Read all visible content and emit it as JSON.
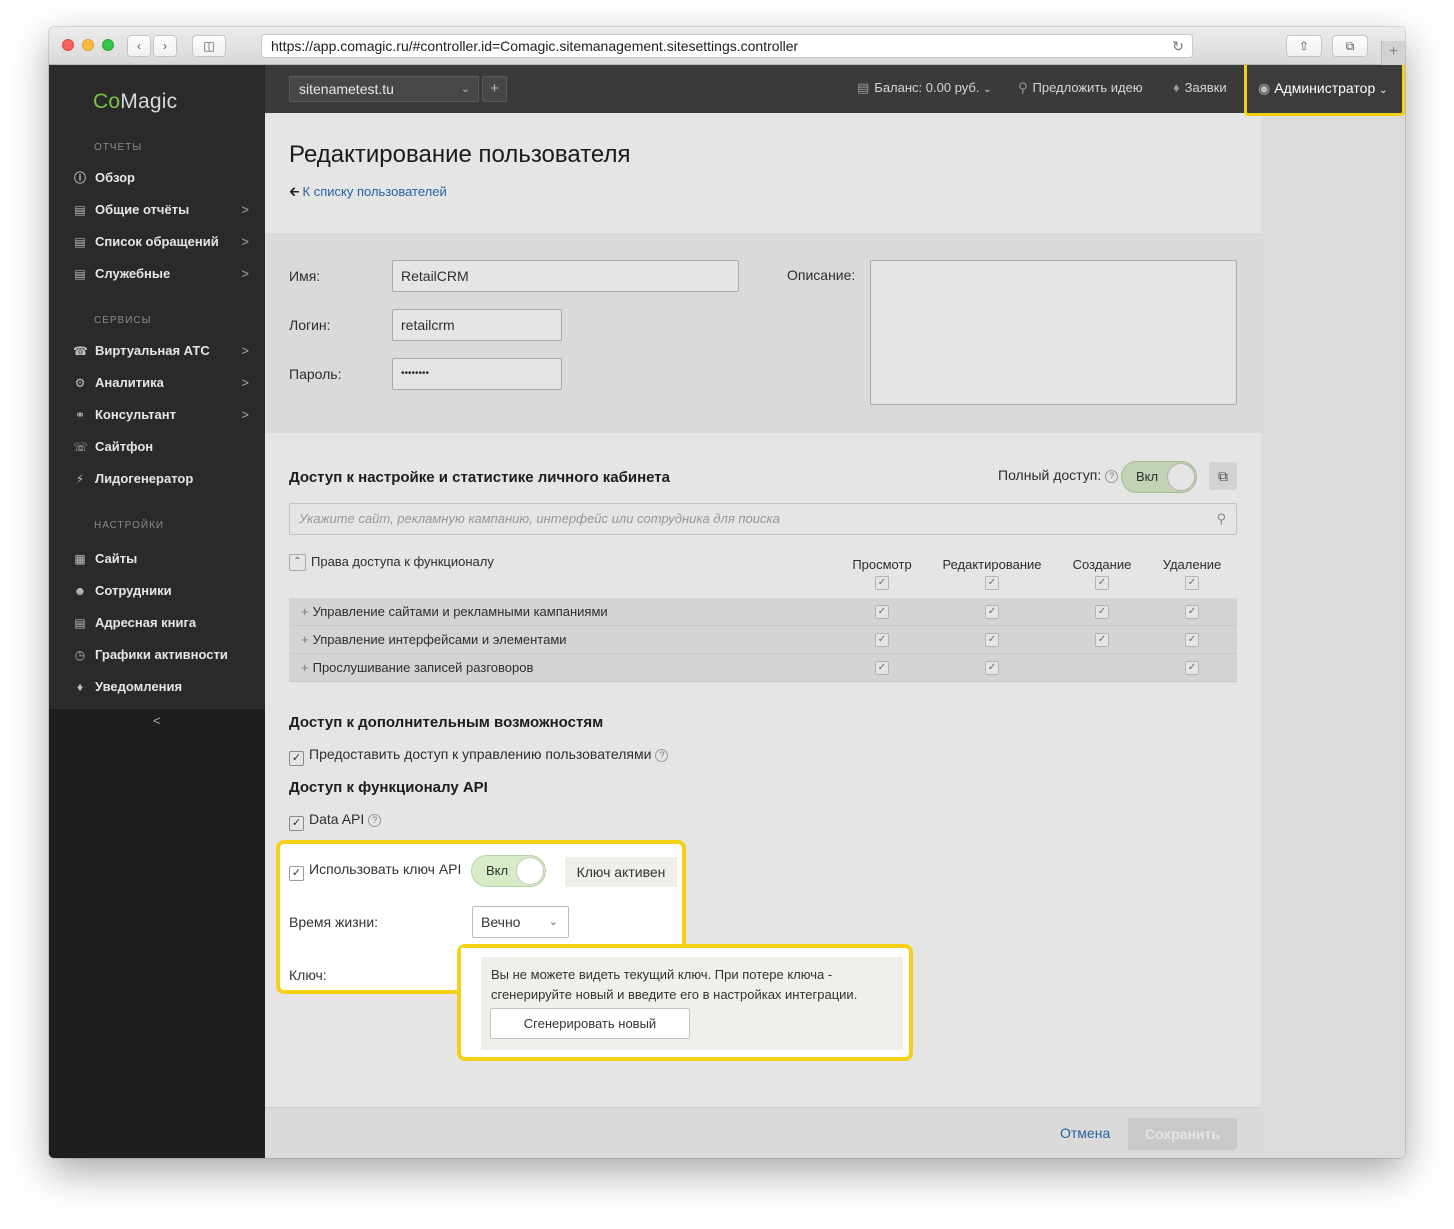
{
  "browser": {
    "url": "https://app.comagic.ru/#controller.id=Comagic.sitemanagement.sitesettings.controller"
  },
  "sidebar": {
    "logo_co": "Co",
    "logo_magic": "Magic",
    "sections": [
      {
        "title": "ОТЧЕТЫ",
        "items": [
          {
            "label": "Обзор",
            "icon": "info-icon",
            "arrow": ""
          },
          {
            "label": "Общие отчёты",
            "icon": "chart-icon",
            "arrow": ">"
          },
          {
            "label": "Список обращений",
            "icon": "list-icon",
            "arrow": ">"
          },
          {
            "label": "Служебные",
            "icon": "code-icon",
            "arrow": ">"
          }
        ]
      },
      {
        "title": "СЕРВИСЫ",
        "items": [
          {
            "label": "Виртуальная АТС",
            "icon": "phone-icon",
            "arrow": ">"
          },
          {
            "label": "Аналитика",
            "icon": "gears-icon",
            "arrow": ">"
          },
          {
            "label": "Консультант",
            "icon": "headset-icon",
            "arrow": ">"
          },
          {
            "label": "Сайтфон",
            "icon": "callback-icon",
            "arrow": ""
          },
          {
            "label": "Лидогенератор",
            "icon": "lightning-icon",
            "arrow": ""
          }
        ]
      },
      {
        "title": "НАСТРОЙКИ",
        "items": [
          {
            "label": "Сайты",
            "icon": "sites-icon",
            "arrow": ""
          },
          {
            "label": "Сотрудники",
            "icon": "users-icon",
            "arrow": ""
          },
          {
            "label": "Адресная книга",
            "icon": "addressbook-icon",
            "arrow": ""
          },
          {
            "label": "Графики активности",
            "icon": "clock-icon",
            "arrow": ""
          },
          {
            "label": "Уведомления",
            "icon": "bell-icon",
            "arrow": ""
          }
        ]
      }
    ],
    "collapse": "<"
  },
  "topbar": {
    "site": "sitenametest.tu",
    "add": "+",
    "balance": "Баланс: 0.00 руб.",
    "idea": "Предложить идею",
    "requests": "Заявки",
    "admin": "Администратор"
  },
  "page": {
    "title": "Редактирование пользователя",
    "back": "К списку пользователей",
    "name_label": "Имя:",
    "name_value": "RetailCRM",
    "login_label": "Логин:",
    "login_value": "retailcrm",
    "password_label": "Пароль:",
    "password_value": "••••••••",
    "desc_label": "Описание:"
  },
  "access": {
    "title": "Доступ к настройке и статистике личного кабинета",
    "full_access_label": "Полный доступ:",
    "toggle_on": "Вкл",
    "search_placeholder": "Укажите сайт, рекламную кампанию, интерфейс или сотрудника для поиска",
    "rights_header": "Права доступа к функционалу",
    "columns": [
      "Просмотр",
      "Редактирование",
      "Создание",
      "Удаление"
    ],
    "rows": [
      {
        "label": "Управление сайтами и рекламными кампаниями"
      },
      {
        "label": "Управление интерфейсами и элементами"
      },
      {
        "label": "Прослушивание записей разговоров"
      }
    ]
  },
  "extra": {
    "title": "Доступ к дополнительным возможностям",
    "manage_users": "Предоставить доступ к управлению пользователями"
  },
  "api": {
    "title": "Доступ к функционалу API",
    "data_api": "Data API",
    "use_key": "Использовать ключ API",
    "toggle_on": "Вкл",
    "key_status": "Ключ активен",
    "lifetime_label": "Время жизни:",
    "lifetime_value": "Вечно",
    "key_label": "Ключ:",
    "key_note": "Вы не можете видеть текущий ключ. При потере ключа - сгенерируйте новый и введите его в настройках интеграции.",
    "generate": "Сгенерировать новый"
  },
  "footer": {
    "cancel": "Отмена",
    "save": "Сохранить"
  },
  "colors": {
    "highlight": "#f5cf18",
    "sidebar": "#2a2a2a",
    "link": "#2d6fb3",
    "toggle_on": "#d7ebc9"
  }
}
